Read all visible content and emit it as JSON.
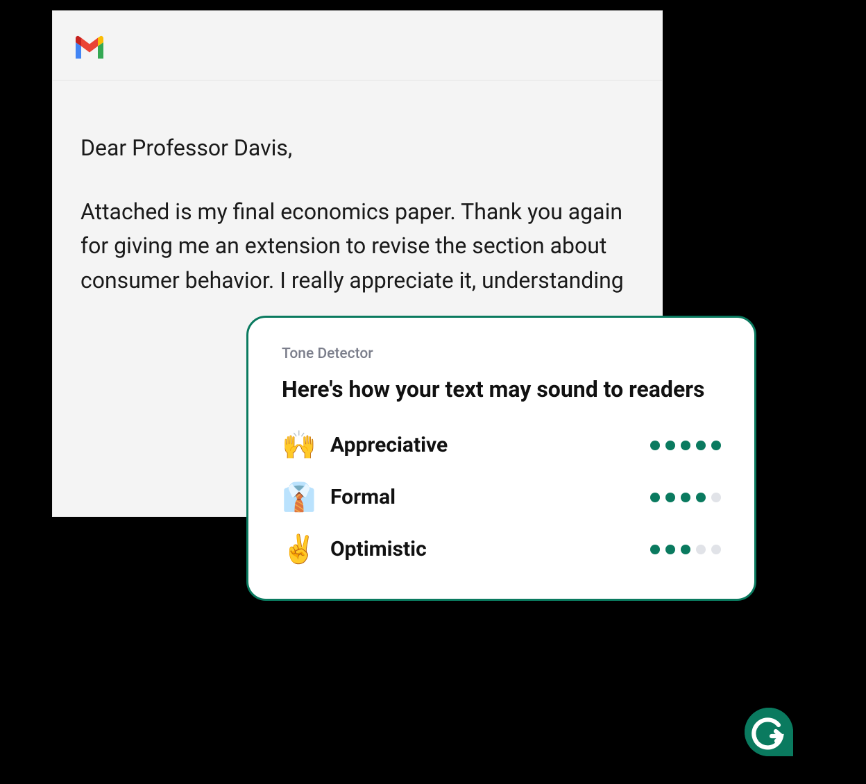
{
  "email": {
    "salutation": "Dear Professor Davis,",
    "body": "Attached is my final economics paper. Thank you again for giving me an extension to revise the section about consumer behavior. I really appreciate it, understanding"
  },
  "tone_detector": {
    "label": "Tone Detector",
    "heading": "Here's how your text may sound to readers",
    "items": [
      {
        "emoji": "🙌",
        "name": "Appreciative",
        "score": 5
      },
      {
        "emoji": "👔",
        "name": "Formal",
        "score": 4
      },
      {
        "emoji": "✌️",
        "name": "Optimistic",
        "score": 3
      }
    ],
    "max_score": 5
  },
  "accent_color": "#0a7a5f"
}
